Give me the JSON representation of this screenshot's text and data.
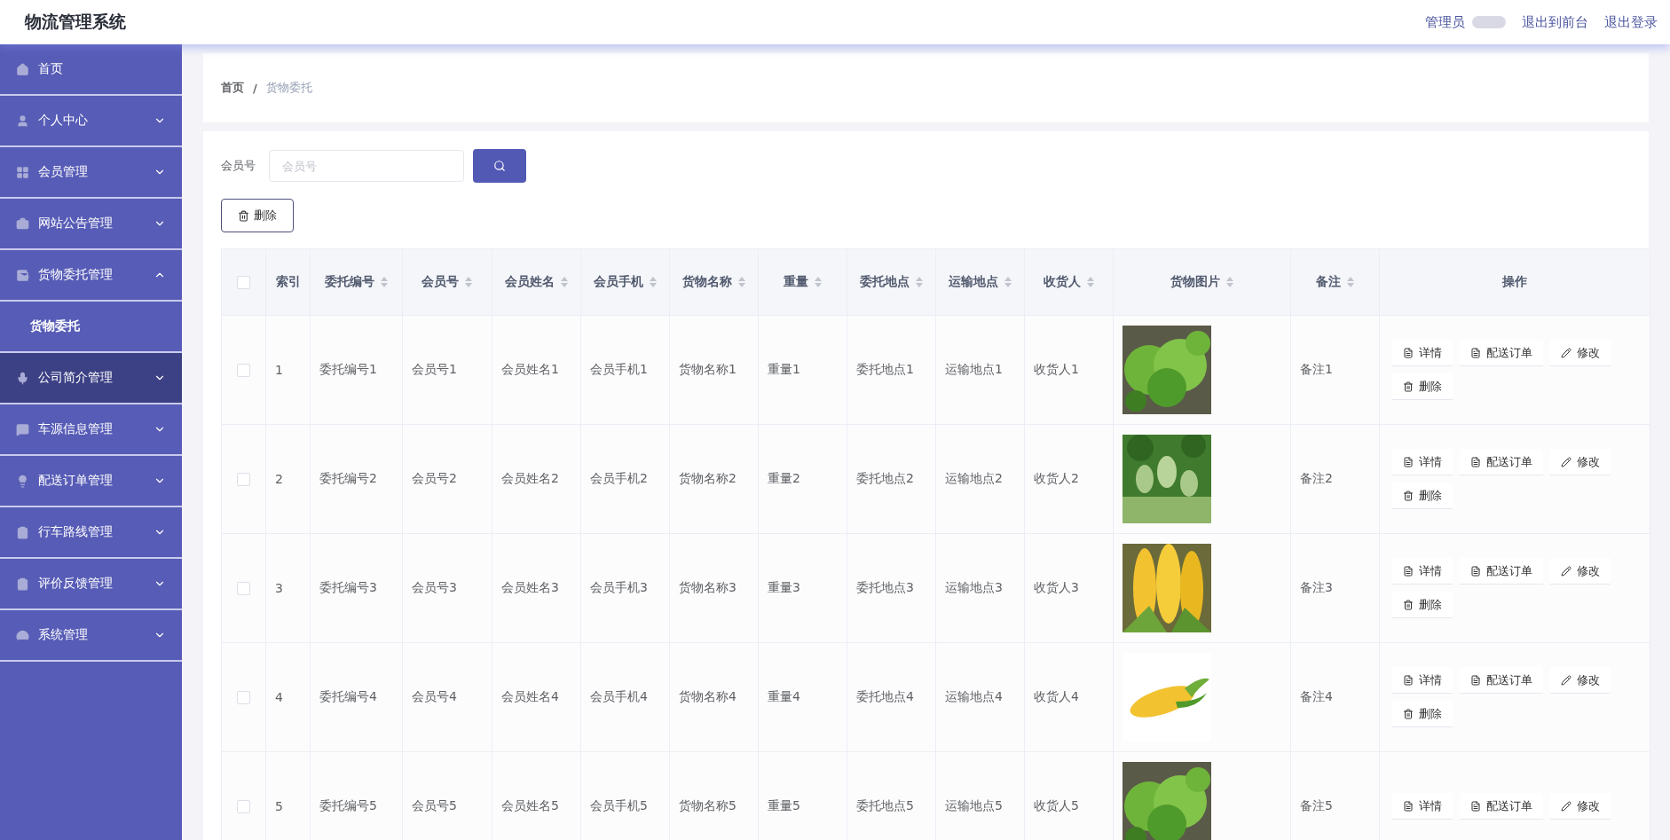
{
  "header": {
    "title": "物流管理系统",
    "role": "管理员",
    "links": [
      "退出到前台",
      "退出登录"
    ]
  },
  "sidebar": {
    "items": [
      {
        "label": "首页",
        "kind": "link",
        "selected": false
      },
      {
        "label": "个人中心",
        "kind": "menu",
        "expanded": false,
        "selected": false
      },
      {
        "label": "会员管理",
        "kind": "menu",
        "expanded": false,
        "selected": false
      },
      {
        "label": "网站公告管理",
        "kind": "menu",
        "expanded": false,
        "selected": false
      },
      {
        "label": "货物委托管理",
        "kind": "menu",
        "expanded": true,
        "selected": false,
        "children": [
          {
            "label": "货物委托",
            "selected": false
          }
        ]
      },
      {
        "label": "公司简介管理",
        "kind": "menu",
        "expanded": false,
        "selected": true
      },
      {
        "label": "车源信息管理",
        "kind": "menu",
        "expanded": false,
        "selected": false
      },
      {
        "label": "配送订单管理",
        "kind": "menu",
        "expanded": false,
        "selected": false
      },
      {
        "label": "行车路线管理",
        "kind": "menu",
        "expanded": false,
        "selected": false
      },
      {
        "label": "评价反馈管理",
        "kind": "menu",
        "expanded": false,
        "selected": false
      },
      {
        "label": "系统管理",
        "kind": "menu",
        "expanded": false,
        "selected": false
      }
    ]
  },
  "breadcrumb": [
    "首页",
    "/",
    "货物委托"
  ],
  "search": {
    "label": "会员号",
    "placeholder": "会员号"
  },
  "delete_button": "删除",
  "table": {
    "all_checked": false,
    "columns": [
      {
        "label": "索引",
        "sortable": false
      },
      {
        "label": "委托编号",
        "sortable": true
      },
      {
        "label": "会员号",
        "sortable": true
      },
      {
        "label": "会员姓名",
        "sortable": true
      },
      {
        "label": "会员手机",
        "sortable": true
      },
      {
        "label": "货物名称",
        "sortable": true
      },
      {
        "label": "重量",
        "sortable": true
      },
      {
        "label": "委托地点",
        "sortable": true
      },
      {
        "label": "运输地点",
        "sortable": true
      },
      {
        "label": "收货人",
        "sortable": true
      },
      {
        "label": "货物图片",
        "sortable": true
      },
      {
        "label": "备注",
        "sortable": true
      },
      {
        "label": "操作",
        "sortable": false
      }
    ],
    "rows": [
      {
        "checked": false,
        "cells": [
          "1",
          "委托编号1",
          "会员号1",
          "会员姓名1",
          "会员手机1",
          "货物名称1",
          "重量1",
          "委托地点1",
          "运输地点1",
          "收货人1"
        ],
        "image": {
          "kind": "picture"
        },
        "note": "备注1",
        "actions": [
          "详情",
          "配送订单",
          "修改",
          "删除"
        ]
      },
      {
        "checked": false,
        "cells": [
          "2",
          "委托编号2",
          "会员号2",
          "会员姓名2",
          "会员手机2",
          "货物名称2",
          "重量2",
          "委托地点2",
          "运输地点2",
          "收货人2"
        ],
        "image": {
          "kind": "picture"
        },
        "note": "备注2",
        "actions": [
          "详情",
          "配送订单",
          "修改",
          "删除"
        ]
      },
      {
        "checked": false,
        "cells": [
          "3",
          "委托编号3",
          "会员号3",
          "会员姓名3",
          "会员手机3",
          "货物名称3",
          "重量3",
          "委托地点3",
          "运输地点3",
          "收货人3"
        ],
        "image": {
          "kind": "picture"
        },
        "note": "备注3",
        "actions": [
          "详情",
          "配送订单",
          "修改",
          "删除"
        ]
      },
      {
        "checked": false,
        "cells": [
          "4",
          "委托编号4",
          "会员号4",
          "会员姓名4",
          "会员手机4",
          "货物名称4",
          "重量4",
          "委托地点4",
          "运输地点4",
          "收货人4"
        ],
        "image": {
          "kind": "picture"
        },
        "note": "备注4",
        "actions": [
          "详情",
          "配送订单",
          "修改",
          "删除"
        ]
      },
      {
        "checked": false,
        "cells": [
          "5",
          "委托编号5",
          "会员号5",
          "会员姓名5",
          "会员手机5",
          "货物名称5",
          "重量5",
          "委托地点5",
          "运输地点5",
          "收货人5"
        ],
        "image": {
          "kind": "picture"
        },
        "note": "备注5",
        "actions": [
          "详情",
          "配送订单",
          "修改"
        ]
      }
    ]
  }
}
